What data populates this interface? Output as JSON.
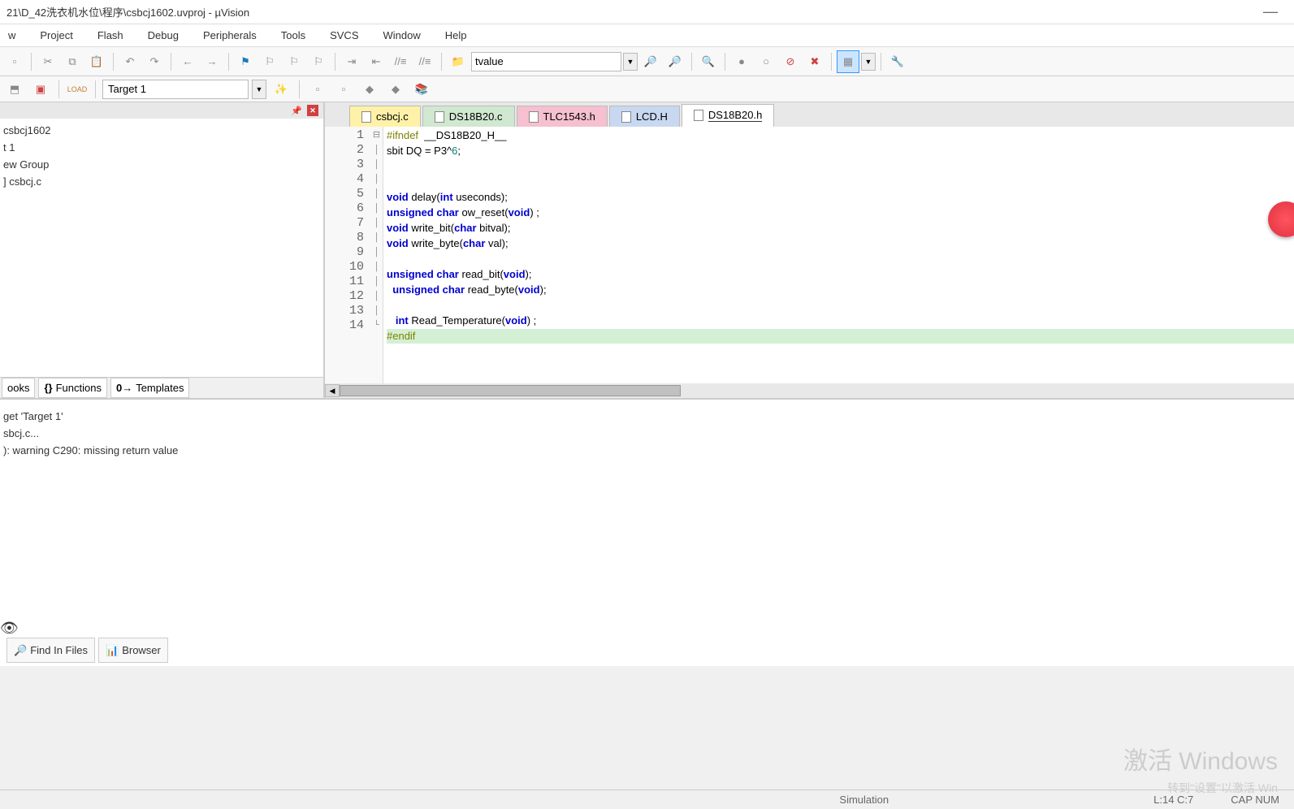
{
  "title": "21\\D_42洗衣机水位\\程序\\csbcj1602.uvproj - µVision",
  "menu": [
    "w",
    "Project",
    "Flash",
    "Debug",
    "Peripherals",
    "Tools",
    "SVCS",
    "Window",
    "Help"
  ],
  "toolbar": {
    "search_value": "tvalue"
  },
  "target_combo": "Target 1",
  "tree": {
    "project": "csbcj1602",
    "target": "t 1",
    "group": "ew Group",
    "file": "csbcj.c"
  },
  "panel_tabs": [
    "ooks",
    "Functions",
    "Templates"
  ],
  "file_tabs": [
    {
      "name": "csbcj.c",
      "cls": "csbcj"
    },
    {
      "name": "DS18B20.c",
      "cls": "ds18c"
    },
    {
      "name": "TLC1543.h",
      "cls": "tlc"
    },
    {
      "name": "LCD.H",
      "cls": "lcd"
    },
    {
      "name": "DS18B20.h",
      "cls": "active"
    }
  ],
  "code_lines": [
    {
      "n": 1,
      "html": "<span class='pp'>#ifndef</span>  __DS18B20_H__"
    },
    {
      "n": 2,
      "html": "sbit DQ = P3^<span class='num'>6</span>;"
    },
    {
      "n": 3,
      "html": ""
    },
    {
      "n": 4,
      "html": ""
    },
    {
      "n": 5,
      "html": "<span class='kw'>void</span> delay(<span class='kw'>int</span> useconds);"
    },
    {
      "n": 6,
      "html": "<span class='kw'>unsigned</span> <span class='kw'>char</span> ow_reset(<span class='kw'>void</span>) ;"
    },
    {
      "n": 7,
      "html": "<span class='kw'>void</span> write_bit(<span class='kw'>char</span> bitval);"
    },
    {
      "n": 8,
      "html": "<span class='kw'>void</span> write_byte(<span class='kw'>char</span> val);"
    },
    {
      "n": 9,
      "html": ""
    },
    {
      "n": 10,
      "html": "<span class='kw'>unsigned</span> <span class='kw'>char</span> read_bit(<span class='kw'>void</span>);"
    },
    {
      "n": 11,
      "html": "  <span class='kw'>unsigned</span> <span class='kw'>char</span> read_byte(<span class='kw'>void</span>);"
    },
    {
      "n": 12,
      "html": ""
    },
    {
      "n": 13,
      "html": "   <span class='kw'>int</span> Read_Temperature(<span class='kw'>void</span>) ;"
    },
    {
      "n": 14,
      "html": "<span class='pp'>#endif</span>",
      "hl": true
    }
  ],
  "output": [
    "get 'Target 1'",
    "sbcj.c...",
    "): warning C290: missing return value"
  ],
  "output_tabs": [
    "Find In Files",
    "Browser"
  ],
  "status": {
    "sim": "Simulation",
    "pos": "L:14 C:7",
    "caps": "CAP NUM"
  },
  "watermark": "激活 Windows",
  "watermark2": "转到\"设置\"以激活 Win"
}
